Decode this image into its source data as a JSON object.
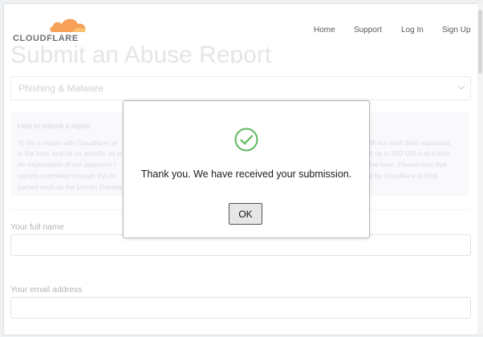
{
  "brand": {
    "name": "CLOUDFLARE",
    "color": "#f38020"
  },
  "nav": {
    "home": "Home",
    "support": "Support",
    "login": "Log In",
    "signup": "Sign Up"
  },
  "page": {
    "title": "Submit an Abuse Report",
    "report_type": "Phishing & Malware",
    "info_title": "How to submit a report",
    "info_lines": [
      "To file a report with Cloudflare, pl",
      "in the form and be as specific as p",
      "An explanation of our approach t",
      "reports submitted through this fo",
      "parties such as the Lumen Databa"
    ],
    "info_lines_right": [
      "fill out each field requested",
      "lt up to 250 URLs at a time.",
      "ble here. Please note that",
      "d by Cloudflare to third"
    ],
    "full_name_label": "Your full name",
    "email_label": "Your email address"
  },
  "dialog": {
    "message": "Thank you. We have received your submission.",
    "ok_label": "OK",
    "success_color": "#5cb85c"
  }
}
